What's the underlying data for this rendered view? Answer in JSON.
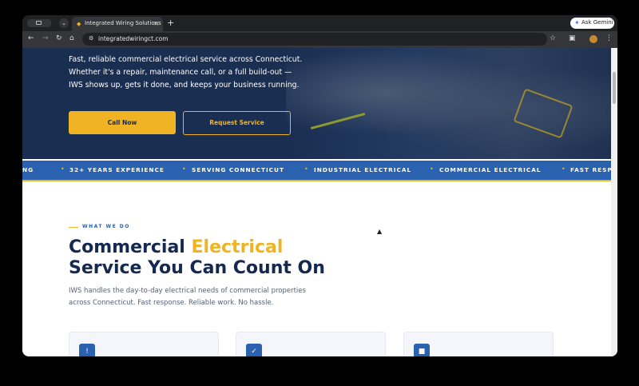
{
  "browser": {
    "tab_title": "Integrated Wiring Solutions",
    "tab_close": "×",
    "new_tab": "+",
    "ask_gemini": "Ask Gemini",
    "url": "integratedwiringct.com",
    "icons": [
      "tab-search-icon",
      "tab-dropdown-icon",
      "favicon-icon",
      "back-icon",
      "forward-icon",
      "reload-icon",
      "home-icon",
      "site-settings-icon",
      "bookmark-star-icon",
      "extensions-icon",
      "profile-avatar",
      "menu-dots-icon"
    ]
  },
  "hero": {
    "text": "Fast, reliable commercial electrical service across Connecticut. Whether it's a repair, maintenance call, or a full build-out — IWS shows up, gets it done, and keeps your business running.",
    "call_button": "Call Now",
    "request_button": "Request Service"
  },
  "ticker": {
    "items": [
      "NG",
      "32+ YEARS EXPERIENCE",
      "SERVING CONNECTICUT",
      "INDUSTRIAL ELECTRICAL",
      "COMMERCIAL ELECTRICAL",
      "FAST RESPO"
    ]
  },
  "services": {
    "eyebrow": "WHAT WE DO",
    "heading_part1": "Commercial ",
    "heading_highlight": "Electrical",
    "heading_line2": "Service You Can Count On",
    "lead": "IWS handles the day-to-day electrical needs of commercial properties across Connecticut. Fast response. Reliable work. No hassle.",
    "cards": [
      {
        "icon": "clock-icon",
        "glyph": "!"
      },
      {
        "icon": "checklist-icon",
        "glyph": "✓"
      },
      {
        "icon": "folder-icon",
        "glyph": "■"
      }
    ]
  },
  "colors": {
    "accent": "#f0b323",
    "navy": "#142850",
    "blue": "#2a62b0"
  }
}
